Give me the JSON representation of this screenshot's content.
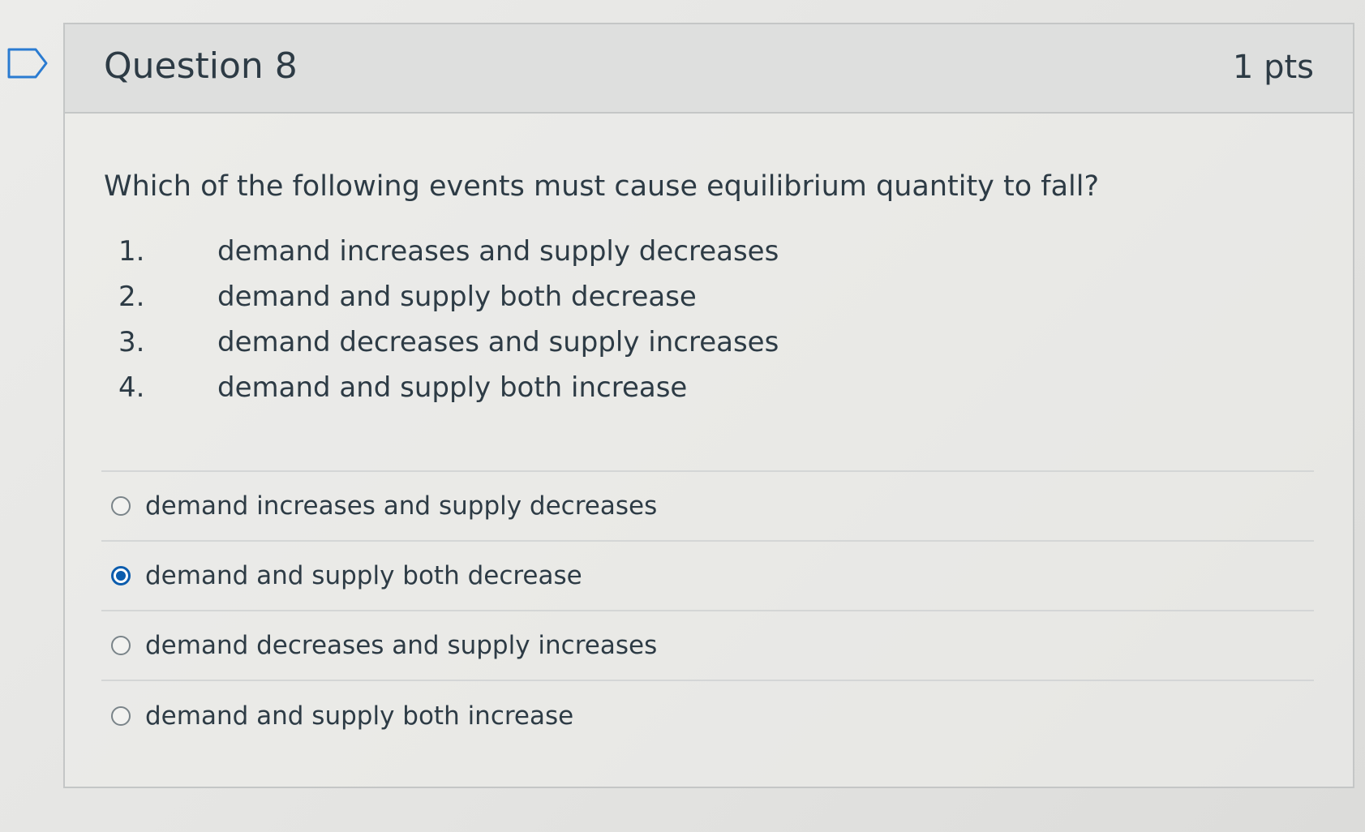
{
  "question": {
    "title": "Question 8",
    "points": "1 pts",
    "prompt": "Which of the following events must cause equilibrium quantity to fall?",
    "events": [
      {
        "number": "1.",
        "text": "demand increases and supply decreases"
      },
      {
        "number": "2.",
        "text": "demand and supply both decrease"
      },
      {
        "number": "3.",
        "text": "demand decreases and supply increases"
      },
      {
        "number": "4.",
        "text": "demand and supply both increase"
      }
    ],
    "answers": [
      {
        "label": "demand increases and supply decreases",
        "selected": false
      },
      {
        "label": "demand and supply both decrease",
        "selected": true
      },
      {
        "label": "demand decreases and supply increases",
        "selected": false
      },
      {
        "label": "demand and supply both increase",
        "selected": false
      }
    ]
  },
  "icons": {
    "flag": "flag-question-icon"
  },
  "colors": {
    "selected_radio": "#0b5cad",
    "text": "#2d3b45"
  }
}
